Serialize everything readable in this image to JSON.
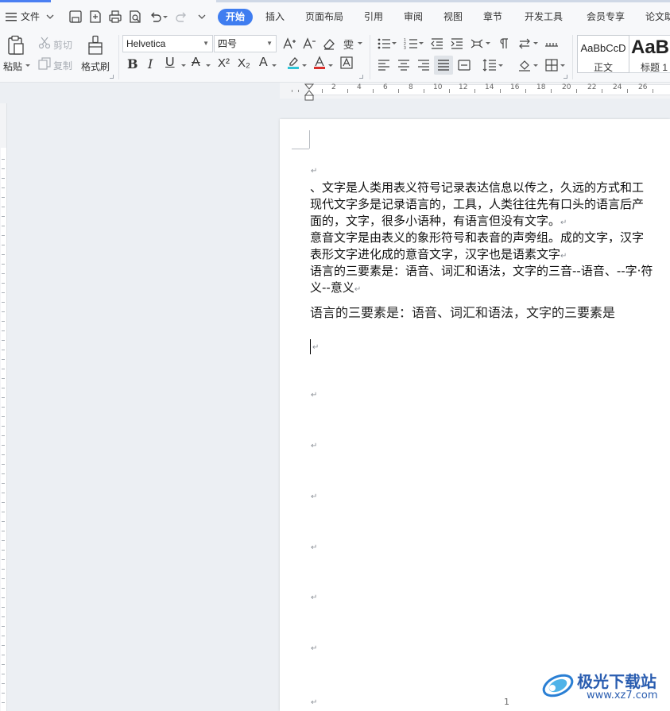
{
  "menu": {
    "file_label": "文件",
    "tabs": [
      "开始",
      "插入",
      "页面布局",
      "引用",
      "审阅",
      "视图",
      "章节",
      "开发工具",
      "会员专享",
      "论文助"
    ],
    "active_tab": "开始"
  },
  "ribbon": {
    "paste_label": "粘贴",
    "cut_label": "剪切",
    "copy_label": "复制",
    "format_painter_label": "格式刷",
    "font_name": "Helvetica",
    "font_size": "四号",
    "styles": [
      {
        "preview": "AaBbCcD",
        "name": "正文"
      },
      {
        "preview": "AaB",
        "name": "标题 1"
      }
    ]
  },
  "ruler": {
    "labels": [
      "2",
      "4",
      "6",
      "8",
      "10",
      "12",
      "14",
      "16",
      "18",
      "20",
      "22",
      "24",
      "26"
    ]
  },
  "document": {
    "paragraphs": [
      "、文字是人类用表义符号记录表达信息以传之，久远的方式和工",
      "现代文字多是记录语言的，工具，人类往往先有口头的语言后产",
      "面的，文字，很多小语种，有语言但没有文字。",
      "意音文字是由表义的象形符号和表音的声旁组。成的文字，汉字",
      "表形文字进化成的意音文字，汉字也是语素文字",
      "语言的三要素是：语音、词汇和语法，文字的三音--语音、--字·符",
      "义--意义",
      "语言的三要素是：语音、词汇和语法，文字的三要素是"
    ],
    "paragraph_mark": "↵",
    "page_number": "1"
  },
  "watermark": {
    "name": "极光下载站",
    "url": "www.xz7.com"
  },
  "colors": {
    "accent": "#3f7df0",
    "highlight": "#2ec4d6",
    "font_color": "#d9302c"
  }
}
